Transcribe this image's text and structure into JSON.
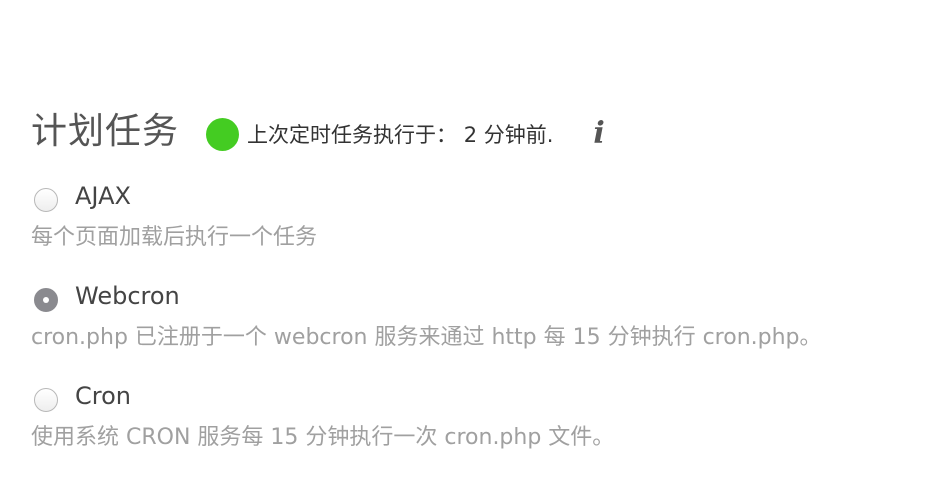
{
  "cron": {
    "title": "计划任务",
    "status_color": "#44cc22",
    "status_text": "上次定时任务执行于： 2 分钟前.",
    "info_icon": "info-icon",
    "options": [
      {
        "label": "AJAX",
        "checked": false,
        "description": "每个页面加载后执行一个任务"
      },
      {
        "label": "Webcron",
        "checked": true,
        "description": "cron.php 已注册于一个 webcron 服务来通过 http 每 15 分钟执行 cron.php。"
      },
      {
        "label": "Cron",
        "checked": false,
        "description": "使用系统 CRON 服务每 15 分钟执行一次 cron.php 文件。"
      }
    ]
  }
}
